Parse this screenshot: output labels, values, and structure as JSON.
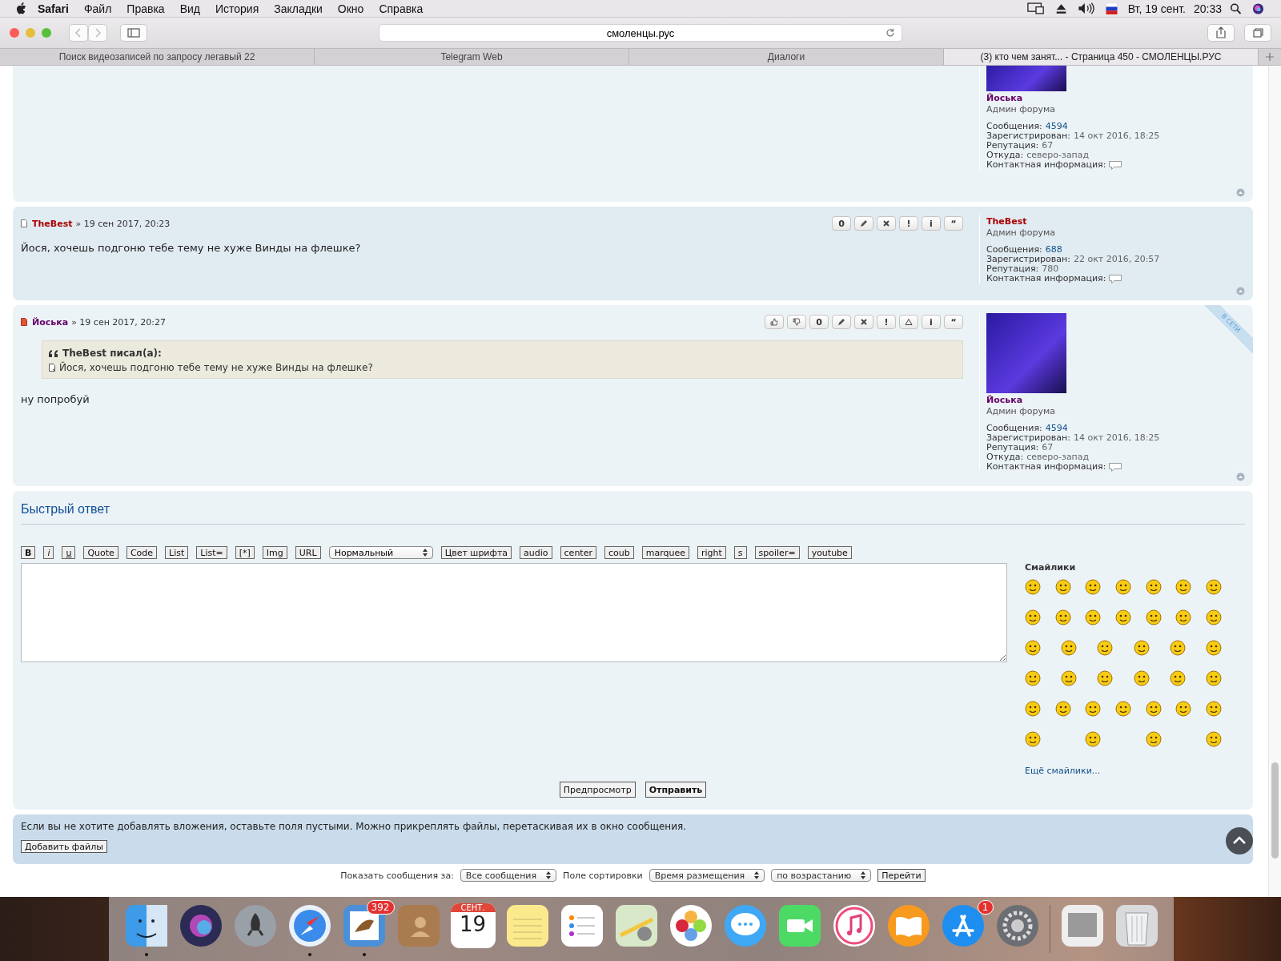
{
  "menubar": {
    "app": "Safari",
    "menus": [
      "Файл",
      "Правка",
      "Вид",
      "История",
      "Закладки",
      "Окно",
      "Справка"
    ],
    "date": "Вт, 19 сент.",
    "time": "20:33"
  },
  "toolbar": {
    "address": "смоленцы.рус"
  },
  "tabs": [
    {
      "label": "Поиск видеозаписей по запросу легавый 22",
      "selected": false
    },
    {
      "label": "Telegram Web",
      "selected": false
    },
    {
      "label": "Диалоги",
      "selected": false
    },
    {
      "label": "(3) кто чем занят... - Страница 450 - СМОЛЕНЦЫ.РУС",
      "selected": true
    }
  ],
  "posts": [
    {
      "profile": {
        "name": "Йоська",
        "color": "#660066",
        "rank": "Админ форума",
        "avatar": true,
        "stats": [
          {
            "label": "Сообщения:",
            "value": "4594",
            "link": true
          },
          {
            "label": "Зарегистрирован:",
            "value": "14 окт 2016, 18:25",
            "link": false
          },
          {
            "label": "Репутация:",
            "value": "67",
            "link": false
          },
          {
            "label": "Откуда:",
            "value": "северо-запад",
            "link": false
          }
        ],
        "contact": "Контактная информация:"
      }
    },
    {
      "author": "TheBest",
      "unread": false,
      "date": "» 19 сен 2017, 20:23",
      "actions": [
        {
          "kind": "text",
          "label": "0"
        },
        {
          "kind": "edit"
        },
        {
          "kind": "delete"
        },
        {
          "kind": "text",
          "label": "!"
        },
        {
          "kind": "text",
          "label": "i"
        },
        {
          "kind": "text",
          "label": "“"
        }
      ],
      "body": "Йося, хочешь подгоню тебе тему не хуже Винды на флешке?",
      "profile": {
        "name": "TheBest",
        "color": "#aa0000",
        "rank": "Админ форума",
        "avatar": false,
        "stats": [
          {
            "label": "Сообщения:",
            "value": "688",
            "link": true
          },
          {
            "label": "Зарегистрирован:",
            "value": "22 окт 2016, 20:57",
            "link": false
          },
          {
            "label": "Репутация:",
            "value": "780",
            "link": false
          }
        ],
        "contact": "Контактная информация:"
      }
    },
    {
      "author": "Йоська",
      "unread": true,
      "date": "» 19 сен 2017, 20:27",
      "online": "В СЕТИ",
      "actions": [
        {
          "kind": "like"
        },
        {
          "kind": "dislike"
        },
        {
          "kind": "text",
          "label": "0"
        },
        {
          "kind": "edit"
        },
        {
          "kind": "delete"
        },
        {
          "kind": "text",
          "label": "!"
        },
        {
          "kind": "warn"
        },
        {
          "kind": "text",
          "label": "i"
        },
        {
          "kind": "text",
          "label": "“"
        }
      ],
      "quote": {
        "title": "TheBest писал(а):",
        "text": "Йося, хочешь подгоню тебе тему не хуже Винды на флешке?"
      },
      "body": "ну попробуй",
      "profile": {
        "name": "Йоська",
        "color": "#660066",
        "rank": "Админ форума",
        "avatar": true,
        "stats": [
          {
            "label": "Сообщения:",
            "value": "4594",
            "link": true
          },
          {
            "label": "Зарегистрирован:",
            "value": "14 окт 2016, 18:25",
            "link": false
          },
          {
            "label": "Репутация:",
            "value": "67",
            "link": false
          },
          {
            "label": "Откуда:",
            "value": "северо-запад",
            "link": false
          }
        ],
        "contact": "Контактная информация:"
      }
    }
  ],
  "reply": {
    "title": "Быстрый ответ",
    "buttons_before": [
      {
        "label": "B",
        "kind": "bold"
      },
      {
        "label": "i",
        "kind": "italic"
      },
      {
        "label": "u",
        "kind": "underline"
      },
      {
        "label": "Quote",
        "kind": "plain"
      },
      {
        "label": "Code",
        "kind": "plain"
      },
      {
        "label": "List",
        "kind": "plain"
      },
      {
        "label": "List=",
        "kind": "plain"
      },
      {
        "label": "[*]",
        "kind": "plain"
      },
      {
        "label": "Img",
        "kind": "plain"
      },
      {
        "label": "URL",
        "kind": "plain"
      }
    ],
    "font_size": "Нормальный",
    "buttons_after": [
      "Цвет шрифта",
      "audio",
      "center",
      "coub",
      "marquee",
      "right",
      "s",
      "spoiler=",
      "youtube"
    ],
    "smilies_title": "Смайлики",
    "more_smilies": "Ещё смайлики...",
    "preview": "Предпросмотр",
    "submit": "Отправить"
  },
  "attachments": {
    "notice": "Если вы не хотите добавлять вложения, оставьте поля пустыми. Можно прикреплять файлы, перетаскивая их в окно сообщения.",
    "button": "Добавить файлы"
  },
  "footer": {
    "show_label": "Показать сообщения за:",
    "show_value": "Все сообщения",
    "sort_label": "Поле сортировки",
    "sort_value": "Время размещения",
    "order_value": "по возрастанию",
    "go": "Перейти"
  },
  "dock": [
    {
      "kind": "finder",
      "running": true
    },
    {
      "kind": "siri",
      "running": false
    },
    {
      "kind": "launchpad",
      "running": false
    },
    {
      "kind": "safari",
      "running": true
    },
    {
      "kind": "mail",
      "running": true,
      "badge": "392"
    },
    {
      "kind": "contacts",
      "running": false
    },
    {
      "kind": "calendar",
      "running": false,
      "month": "СЕНТ.",
      "day": "19"
    },
    {
      "kind": "notes",
      "running": false
    },
    {
      "kind": "reminders",
      "running": false
    },
    {
      "kind": "maps",
      "running": false
    },
    {
      "kind": "photos",
      "running": false
    },
    {
      "kind": "messages",
      "running": false
    },
    {
      "kind": "facetime",
      "running": false
    },
    {
      "kind": "music",
      "running": false
    },
    {
      "kind": "books",
      "running": false
    },
    {
      "kind": "appstore",
      "running": false,
      "badge": "1"
    },
    {
      "kind": "settings",
      "running": false
    },
    {
      "kind": "separator"
    },
    {
      "kind": "document",
      "running": false
    },
    {
      "kind": "trash",
      "running": false
    }
  ]
}
